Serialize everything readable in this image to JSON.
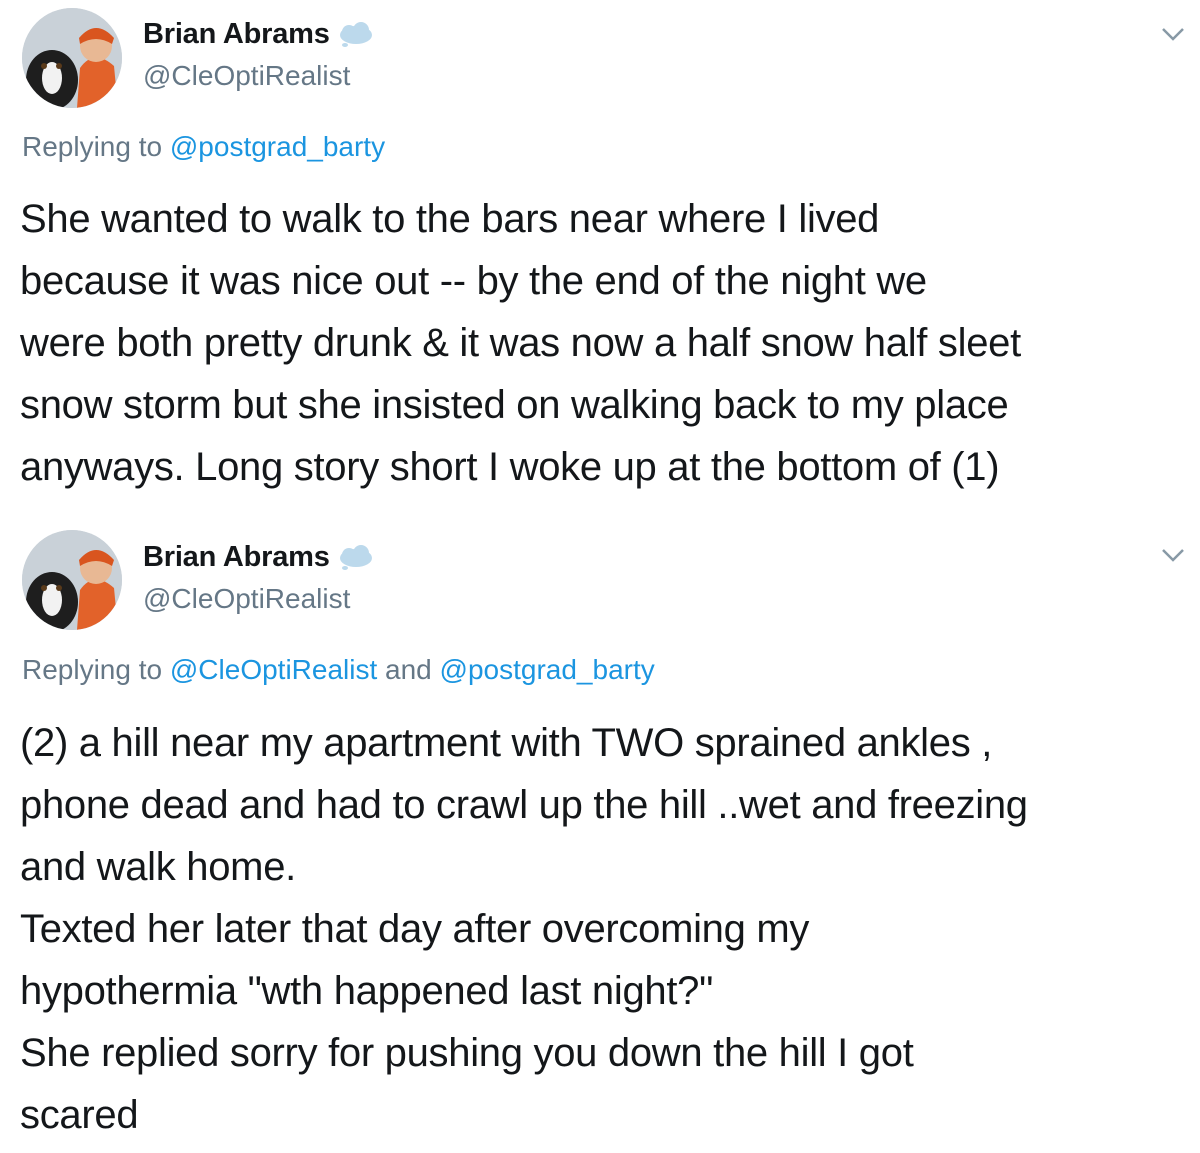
{
  "colors": {
    "link": "#1b95e0",
    "secondary": "#657786",
    "text": "#14171a",
    "cloud": "#bcd9ec"
  },
  "tweets": [
    {
      "author": {
        "name": "Brian Abrams",
        "handle": "@CleOptiRealist",
        "badge_icon": "cloud-icon",
        "avatar": "avatar"
      },
      "reply": {
        "prefix": "Replying to",
        "mention1": "@postgrad_barty",
        "joiner": "",
        "mention2": ""
      },
      "text": "She wanted to walk to the bars near where I lived\nbecause it was nice out -- by the end of the night we\nwere both pretty drunk & it was now a half snow half sleet\nsnow storm but she insisted on walking back to my place\nanyways.  Long story short I woke up at the bottom of (1)",
      "menu_icon": "chevron-down-icon"
    },
    {
      "author": {
        "name": "Brian Abrams",
        "handle": "@CleOptiRealist",
        "badge_icon": "cloud-icon",
        "avatar": "avatar"
      },
      "reply": {
        "prefix": "Replying to",
        "mention1": "@CleOptiRealist",
        "joiner": "and",
        "mention2": "@postgrad_barty"
      },
      "text": "(2) a hill near my apartment with TWO sprained ankles ,\nphone dead and had to crawl up the hill ..wet and freezing\nand walk home.\nTexted her later that day after overcoming my\nhypothermia \"wth happened last night?\"\nShe replied sorry for pushing you down the hill I got\nscared",
      "menu_icon": "chevron-down-icon"
    }
  ]
}
